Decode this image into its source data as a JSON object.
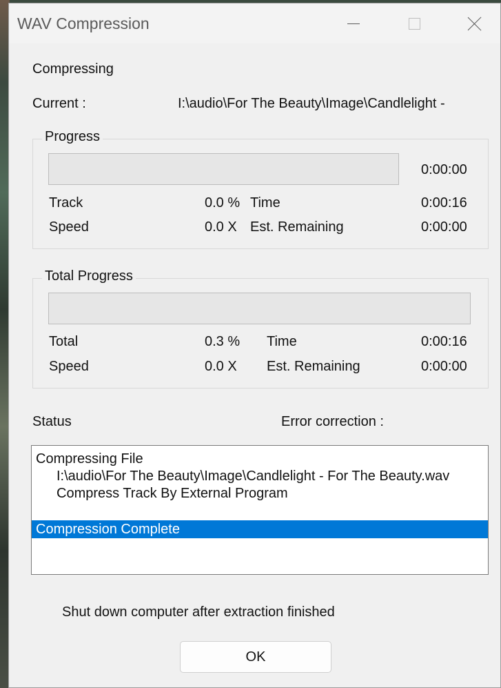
{
  "window": {
    "title": "WAV Compression"
  },
  "header": {
    "status_label": "Compressing",
    "current_label": "Current :",
    "current_value": "I:\\audio\\For The Beauty\\Image\\Candlelight -"
  },
  "progress_group": {
    "title": "Progress",
    "bar_fraction": 0.0,
    "bar_time": "0:00:00",
    "track_label": "Track",
    "track_value": "0.0 %",
    "time_label": "Time",
    "time_value": "0:00:16",
    "speed_label": "Speed",
    "speed_value": "0.0 X",
    "remaining_label": "Est. Remaining",
    "remaining_value": "0:00:00"
  },
  "total_group": {
    "title": "Total Progress",
    "bar_fraction": 0.0,
    "total_label": "Total",
    "total_value": "0.3 %",
    "time_label": "Time",
    "time_value": "0:00:16",
    "speed_label": "Speed",
    "speed_value": "0.0 X",
    "remaining_label": "Est. Remaining",
    "remaining_value": "0:00:00"
  },
  "status": {
    "label": "Status",
    "error_correction_label": "Error correction :",
    "log": [
      "Compressing File",
      "I:\\audio\\For The Beauty\\Image\\Candlelight - For The Beauty.wav",
      "Compress Track By External Program",
      "",
      "Compression Complete"
    ],
    "selected_index": 4
  },
  "footer": {
    "shutdown_text": "Shut down computer after extraction finished",
    "ok_label": "OK"
  },
  "colors": {
    "selection": "#0078d7",
    "dialog_bg": "#f0f0f0",
    "progress_fill": "#06b025"
  }
}
